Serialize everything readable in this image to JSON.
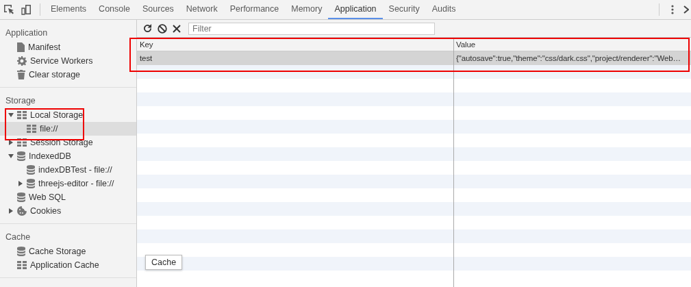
{
  "tabs": [
    {
      "label": "Elements",
      "selected": false
    },
    {
      "label": "Console",
      "selected": false
    },
    {
      "label": "Sources",
      "selected": false
    },
    {
      "label": "Network",
      "selected": false
    },
    {
      "label": "Performance",
      "selected": false
    },
    {
      "label": "Memory",
      "selected": false
    },
    {
      "label": "Application",
      "selected": true
    },
    {
      "label": "Security",
      "selected": false
    },
    {
      "label": "Audits",
      "selected": false
    }
  ],
  "sidebar": {
    "sections": [
      {
        "title": "Application",
        "items": [
          {
            "label": "Manifest",
            "kind": "file",
            "selected": false
          },
          {
            "label": "Service Workers",
            "kind": "gear",
            "selected": false
          },
          {
            "label": "Clear storage",
            "kind": "trash",
            "selected": false
          }
        ]
      },
      {
        "title": "Storage",
        "items": [
          {
            "label": "Local Storage",
            "kind": "grid",
            "selected": false,
            "expanded": true,
            "children": [
              {
                "label": "file://",
                "kind": "grid",
                "selected": true
              }
            ]
          },
          {
            "label": "Session Storage",
            "kind": "grid",
            "selected": false,
            "expanded": false
          },
          {
            "label": "IndexedDB",
            "kind": "db",
            "selected": false,
            "expanded": true,
            "children": [
              {
                "label": "indexDBTest - file://",
                "kind": "db",
                "selected": false
              },
              {
                "label": "threejs-editor - file://",
                "kind": "db",
                "selected": false,
                "expanded": false
              }
            ]
          },
          {
            "label": "Web SQL",
            "kind": "db",
            "selected": false
          },
          {
            "label": "Cookies",
            "kind": "cookie",
            "selected": false,
            "expanded": false
          }
        ]
      },
      {
        "title": "Cache",
        "items": [
          {
            "label": "Cache Storage",
            "kind": "db",
            "selected": false
          },
          {
            "label": "Application Cache",
            "kind": "grid",
            "selected": false
          }
        ]
      }
    ]
  },
  "tooltip": "Cache",
  "filter": {
    "placeholder": "Filter"
  },
  "table": {
    "columns": [
      "Key",
      "Value"
    ],
    "rows": [
      {
        "cells": [
          "test",
          "{\"autosave\":true,\"theme\":\"css/dark.css\",\"project/renderer\":\"Web…"
        ],
        "selected": true
      }
    ]
  }
}
